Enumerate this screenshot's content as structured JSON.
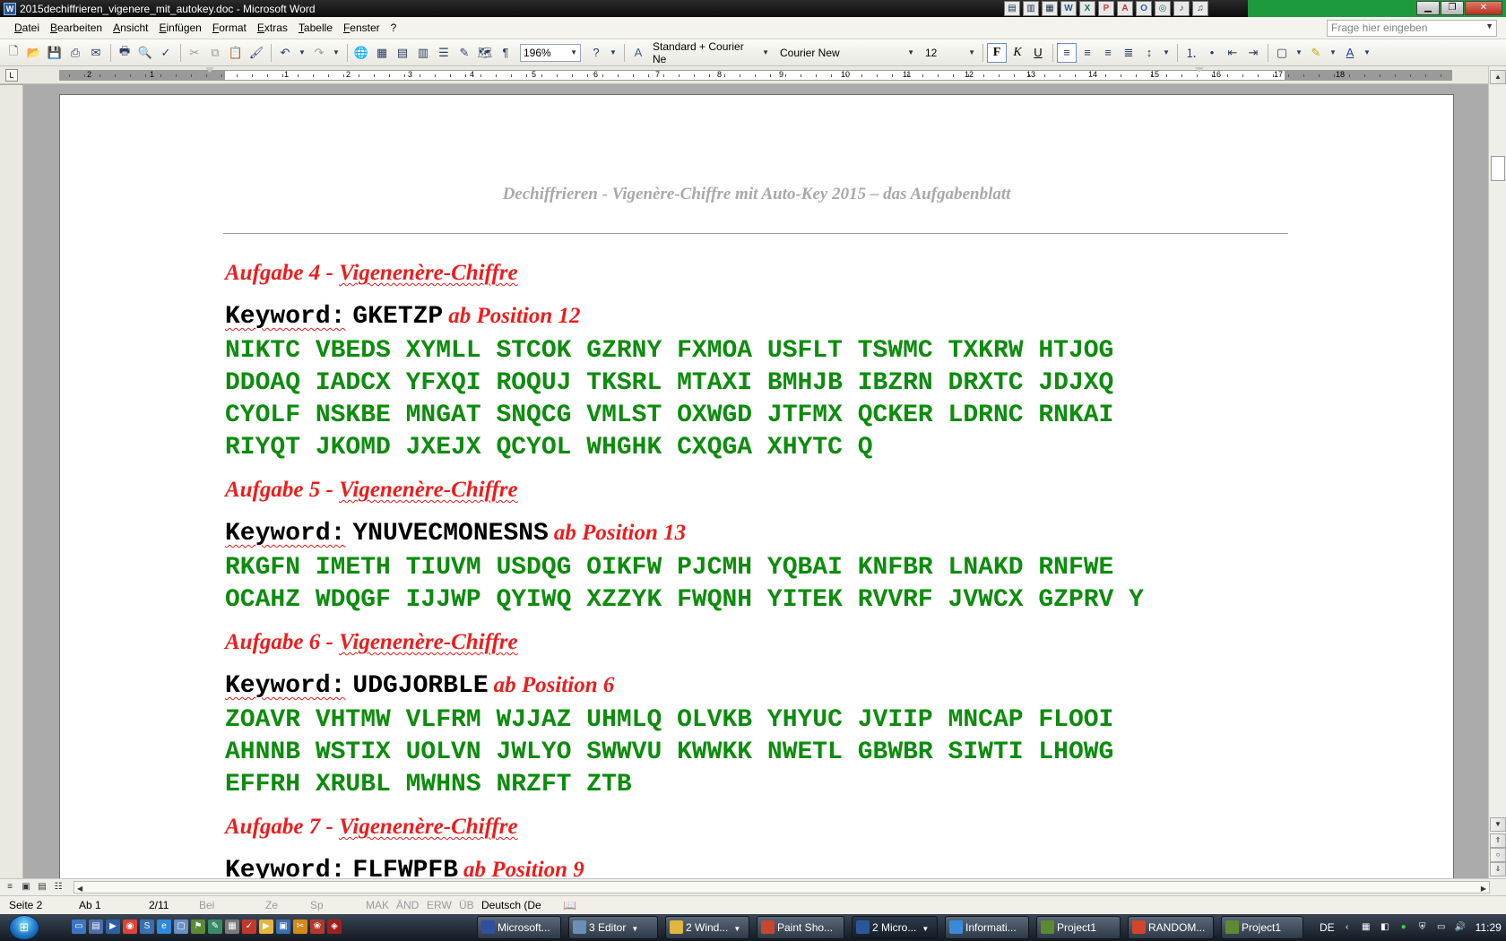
{
  "window": {
    "title": "2015dechiffrieren_vigenere_mit_autokey.doc - Microsoft Word",
    "app_icon_letter": "W"
  },
  "menu": {
    "items": [
      "Datei",
      "Bearbeiten",
      "Ansicht",
      "Einfügen",
      "Format",
      "Extras",
      "Tabelle",
      "Fenster",
      "?"
    ],
    "help_placeholder": "Frage hier eingeben"
  },
  "toolbar": {
    "zoom": "196%",
    "style": "Standard + Courier Ne",
    "font": "Courier New",
    "size": "12",
    "bold_label": "F",
    "italic_label": "K",
    "underline_label": "U"
  },
  "ruler": {
    "labels_left": [
      "2",
      "1"
    ],
    "labels_right": [
      "1",
      "2",
      "3",
      "4",
      "5",
      "6",
      "7",
      "8",
      "9",
      "10",
      "11",
      "12",
      "13",
      "14",
      "15",
      "16",
      "17",
      "18"
    ]
  },
  "document": {
    "header": "Dechiffrieren - Vigenère-Chiffre mit Auto-Key 2015 – das Aufgabenblatt",
    "tasks": [
      {
        "title_prefix": "Aufgabe 4 - ",
        "title_word": "Vigenenère-Chiffre",
        "keyword_label": "Keyword:",
        "keyword": "GKETZP",
        "position": "ab Position 12",
        "lines": [
          "NIKTC VBEDS XYMLL STCOK GZRNY FXMOA USFLT TSWMC TXKRW HTJOG",
          "DDOAQ IADCX YFXQI ROQUJ TKSRL MTAXI BMHJB IBZRN DRXTC JDJXQ",
          "CYOLF NSKBE MNGAT SNQCG VMLST OXWGD JTFMX QCKER LDRNC RNKAI",
          "RIYQT JKOMD JXEJX QCYOL WHGHK CXQGA XHYTC Q"
        ]
      },
      {
        "title_prefix": "Aufgabe 5 - ",
        "title_word": "Vigenenère-Chiffre",
        "keyword_label": "Keyword:",
        "keyword": "YNUVECMONESNS",
        "position": "ab Position 13",
        "lines": [
          "RKGFN IMETH TIUVM USDQG OIKFW PJCMH YQBAI KNFBR LNAKD RNFWE",
          "OCAHZ WDQGF IJJWP QYIWQ XZZYK FWQNH YITEK RVVRF JVWCX GZPRV Y"
        ]
      },
      {
        "title_prefix": "Aufgabe 6 - ",
        "title_word": "Vigenenère-Chiffre",
        "keyword_label": "Keyword:",
        "keyword": "UDGJORBLE",
        "position": "ab Position 6",
        "lines": [
          "ZOAVR VHTMW VLFRM WJJAZ UHMLQ OLVKB YHYUC JVIIP MNCAP FLOOI",
          "AHNNB WSTIX UOLVN JWLYO SWWVU KWWKK NWETL GBWBR SIWTI LHOWG",
          "EFFRH XRUBL MWHNS NRZFT ZTB"
        ]
      },
      {
        "title_prefix": "Aufgabe 7 - ",
        "title_word": "Vigenenère-Chiffre",
        "keyword_label": "Keyword:",
        "keyword": "FLFWPFB",
        "position": "ab Position 9",
        "lines": []
      }
    ]
  },
  "status": {
    "page": "Seite 2",
    "section": "Ab 1",
    "pages": "2/11",
    "at": "Bei",
    "line": "Ze",
    "col": "Sp",
    "mak": "MAK",
    "and": "ÄND",
    "erw": "ERW",
    "ub": "ÜB",
    "language": "Deutsch (De"
  },
  "taskbar": {
    "buttons": [
      {
        "label": "Microsoft...",
        "arrow": false,
        "color": "#2f4f9f"
      },
      {
        "label": "3 Editor",
        "arrow": true,
        "color": "#6b8fb5"
      },
      {
        "label": "2 Wind...",
        "arrow": true,
        "color": "#e0b640"
      },
      {
        "label": "Paint Sho...",
        "arrow": false,
        "color": "#c7462f"
      },
      {
        "label": "2 Micro...",
        "arrow": true,
        "color": "#2b579a"
      },
      {
        "label": "Informati...",
        "arrow": false,
        "color": "#3a8ad8"
      },
      {
        "label": "Project1",
        "arrow": false,
        "color": "#5c8a32"
      },
      {
        "label": "RANDOM...",
        "arrow": false,
        "color": "#d4442d"
      },
      {
        "label": "Project1",
        "arrow": false,
        "color": "#5c8a32"
      }
    ],
    "language": "DE",
    "clock": "11:29"
  },
  "colors": {
    "cipher_green": "#0d8c0d",
    "title_red": "#ee1c1c",
    "header_grey": "#a9a9a9"
  }
}
